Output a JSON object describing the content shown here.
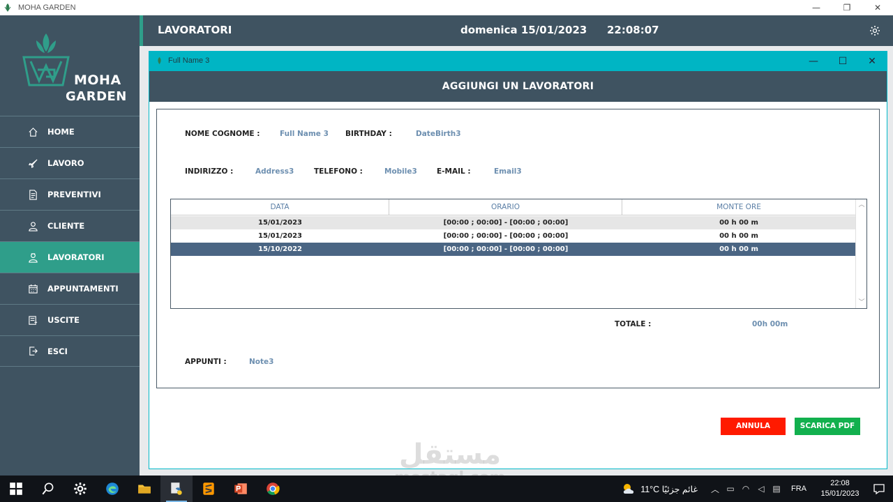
{
  "window": {
    "title": "MOHA GARDEN",
    "controls": [
      "—",
      "❐",
      "✕"
    ]
  },
  "logo": {
    "line1": "MOHA",
    "line2": "GARDEN"
  },
  "sidebar": {
    "items": [
      {
        "label": "HOME",
        "icon": "home-icon"
      },
      {
        "label": "LAVORO",
        "icon": "rocket-icon"
      },
      {
        "label": "PREVENTIVI",
        "icon": "document-icon"
      },
      {
        "label": "CLIENTE",
        "icon": "user-icon"
      },
      {
        "label": "LAVORATORI",
        "icon": "worker-icon",
        "active": true
      },
      {
        "label": "APPUNTAMENTI",
        "icon": "calendar-icon"
      },
      {
        "label": "USCITE",
        "icon": "receipt-icon"
      },
      {
        "label": "ESCI",
        "icon": "logout-icon"
      }
    ]
  },
  "header": {
    "title": "LAVORATORI",
    "date": "domenica 15/01/2023",
    "time": "22:08:07"
  },
  "dialog": {
    "title": "Full Name 3",
    "heading": "AGGIUNGI UN LAVORATORI",
    "controls": [
      "—",
      "☐",
      "✕"
    ],
    "fields": {
      "name_label": "NOME COGNOME :",
      "name_value": "Full Name 3",
      "birthday_label": "BIRTHDAY :",
      "birthday_value": "DateBirth3",
      "address_label": "INDIRIZZO :",
      "address_value": "Address3",
      "phone_label": "TELEFONO :",
      "phone_value": "Mobile3",
      "email_label": "E-MAIL :",
      "email_value": "Email3",
      "total_label": "TOTALE :",
      "total_value": "00h 00m",
      "notes_label": "APPUNTI :",
      "notes_value": "Note3"
    },
    "table": {
      "columns": [
        "DATA",
        "ORARIO",
        "MONTE ORE"
      ],
      "rows": [
        [
          "15/01/2023",
          "[00:00 ; 00:00] - [00:00 ; 00:00]",
          "00 h 00 m"
        ],
        [
          "15/01/2023",
          "[00:00 ; 00:00] - [00:00 ; 00:00]",
          "00 h 00 m"
        ],
        [
          "15/10/2022",
          "[00:00 ; 00:00] - [00:00 ; 00:00]",
          "00 h 00 m"
        ]
      ],
      "selected_row": 2
    },
    "buttons": {
      "cancel": "ANNULA",
      "pdf": "SCARICA PDF"
    }
  },
  "watermark": {
    "arabic": "مستقل",
    "latin": "mostaql.com"
  },
  "taskbar": {
    "weather": "11°C  غائم جزئيًا",
    "lang": "FRA",
    "clock_time": "22:08",
    "clock_date": "15/01/2023"
  },
  "colors": {
    "sidebar": "#3f5361",
    "active": "#2f9e8a",
    "dialog_titlebar": "#00b5c4",
    "value_text": "#6d8fb0",
    "selected_row": "#4a6583",
    "cancel": "#ff1a00",
    "pdf": "#12b04e"
  }
}
